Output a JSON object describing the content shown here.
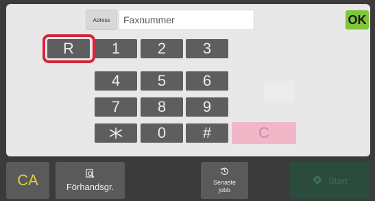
{
  "address": {
    "button_label": "Adress",
    "input_placeholder": "Faxnummer",
    "input_value": ""
  },
  "ok_label": "OK",
  "keypad": {
    "r": "R",
    "k1": "1",
    "k2": "2",
    "k3": "3",
    "k4": "4",
    "k5": "5",
    "k6": "6",
    "k7": "7",
    "k8": "8",
    "k9": "9",
    "k0": "0",
    "hash": "#",
    "star_icon": "asterisk-icon",
    "clear": "C"
  },
  "highlight_color": "#d6243a",
  "bottom": {
    "ca_label": "CA",
    "preview_label": "Förhandsgr.",
    "preview_icon": "preview-magnify-icon",
    "recent_label_line1": "Senaste",
    "recent_label_line2": "jobb",
    "recent_icon": "history-icon",
    "start_label": "Start",
    "start_icon": "start-diamond-icon"
  },
  "colors": {
    "ok_green": "#7fc63b",
    "ca_yellow": "#d9d238",
    "clear_pink": "#f1b7c8",
    "start_disabled_green": "#2b4b3c"
  }
}
